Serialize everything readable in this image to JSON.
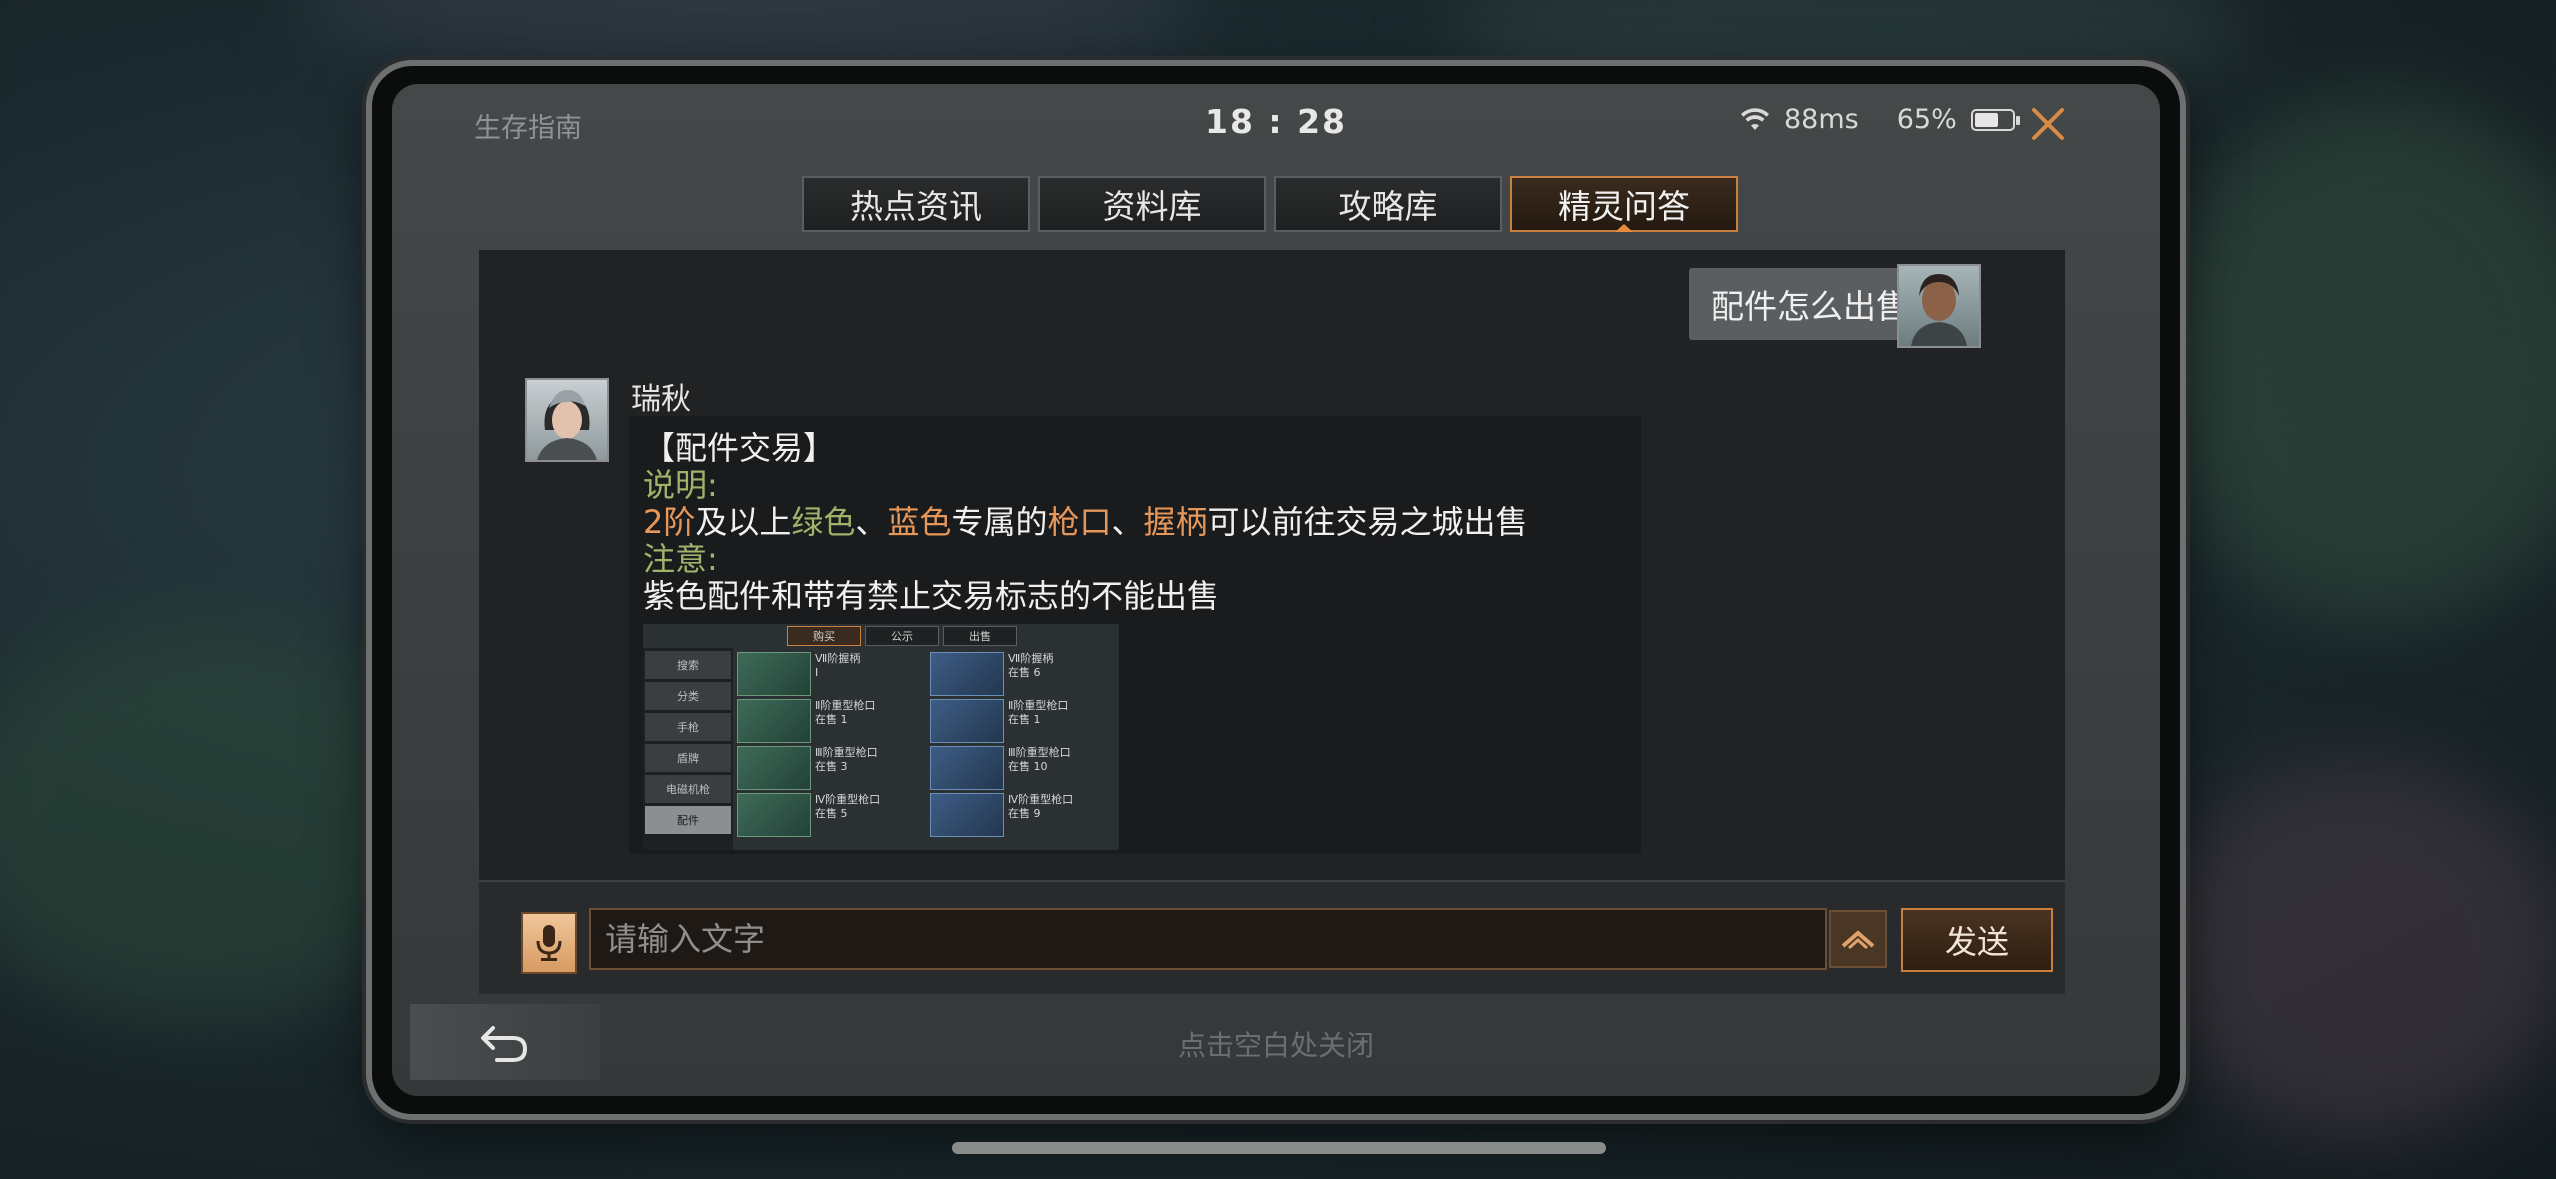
{
  "status": {
    "app_title": "生存指南",
    "time": "18 : 28",
    "ping": "88ms",
    "battery_percent": "65%",
    "battery_level": 0.65
  },
  "tabs": [
    {
      "label": "热点资讯",
      "active": false
    },
    {
      "label": "资料库",
      "active": false
    },
    {
      "label": "攻略库",
      "active": false
    },
    {
      "label": "精灵问答",
      "active": true
    }
  ],
  "chat": {
    "user_message": "配件怎么出售",
    "bot_name": "瑞秋",
    "bot_message": {
      "title": "【配件交易】",
      "note_label": "说明:",
      "line_parts": [
        {
          "text": "2阶",
          "style": "orange"
        },
        {
          "text": "及以上",
          "style": "plain"
        },
        {
          "text": "绿色",
          "style": "green"
        },
        {
          "text": "、",
          "style": "plain"
        },
        {
          "text": "蓝色",
          "style": "orange"
        },
        {
          "text": "专属的",
          "style": "plain"
        },
        {
          "text": "枪口",
          "style": "orange"
        },
        {
          "text": "、",
          "style": "plain"
        },
        {
          "text": "握柄",
          "style": "orange"
        },
        {
          "text": "可以前往交易之城出售",
          "style": "plain"
        }
      ],
      "warning_label": "注意:",
      "warning_text": "紫色配件和带有禁止交易标志的不能出售"
    },
    "screenshot_thumb": {
      "tabs": [
        "购买",
        "公示",
        "出售"
      ],
      "sidebar": [
        "搜索",
        "分类",
        "手枪",
        "盾牌",
        "电磁机枪",
        "配件"
      ],
      "items": [
        {
          "name": "Ⅶ阶握柄",
          "sub": "Ⅰ",
          "color": "green"
        },
        {
          "name": "Ⅶ阶握柄",
          "sub": "在售 6",
          "color": "blue"
        },
        {
          "name": "Ⅱ阶重型枪口",
          "sub": "在售 1",
          "color": "green"
        },
        {
          "name": "Ⅱ阶重型枪口",
          "sub": "在售 1",
          "color": "blue"
        },
        {
          "name": "Ⅲ阶重型枪口",
          "sub": "在售 3",
          "color": "green"
        },
        {
          "name": "Ⅲ阶重型枪口",
          "sub": "在售 10",
          "color": "blue"
        },
        {
          "name": "Ⅳ阶重型枪口",
          "sub": "在售 5",
          "color": "green"
        },
        {
          "name": "Ⅳ阶重型枪口",
          "sub": "在售 9",
          "color": "blue"
        }
      ]
    }
  },
  "input": {
    "placeholder": "请输入文字",
    "value": "",
    "send_label": "发送"
  },
  "footer": {
    "close_hint": "点击空白处关闭"
  }
}
